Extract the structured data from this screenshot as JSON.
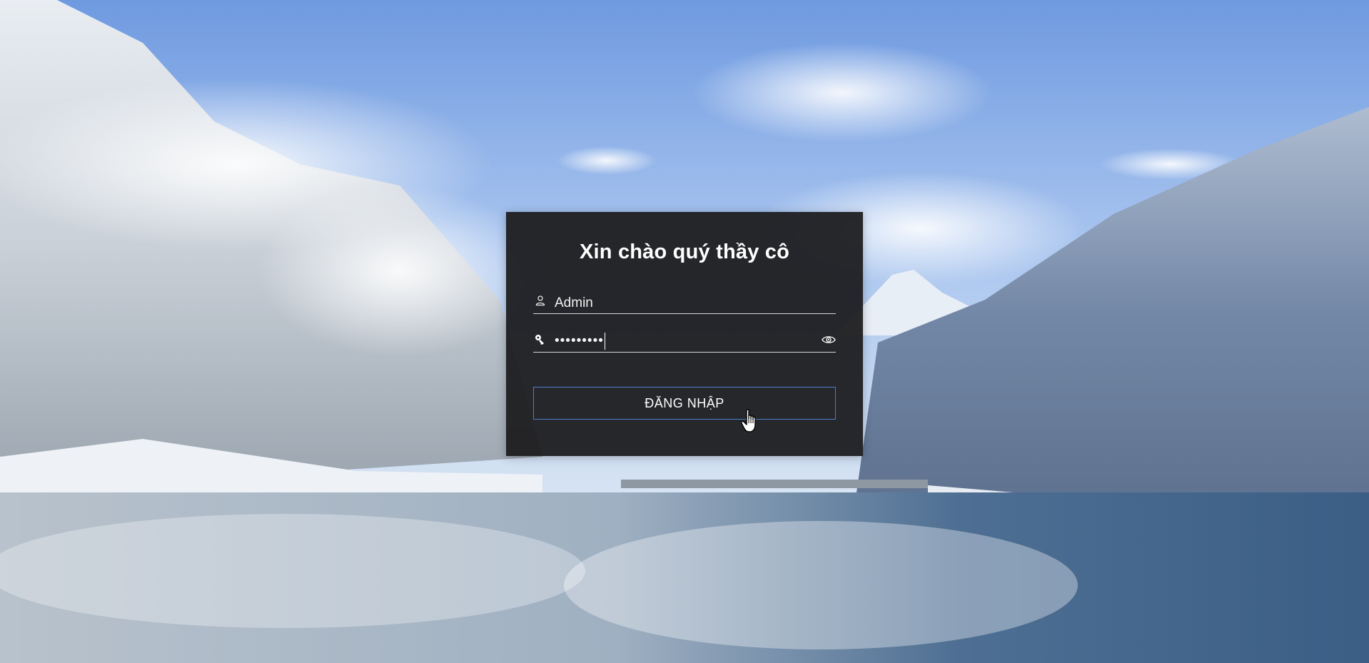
{
  "login": {
    "title": "Xin chào quý thầy cô",
    "username": {
      "value": "Admin",
      "icon": "user-icon"
    },
    "password": {
      "masked_value": "•••••••••",
      "icon": "key-icon",
      "toggle_icon": "eye-icon"
    },
    "submit_label": "ĐĂNG NHẬP"
  },
  "colors": {
    "card_background": "#1c1c1e",
    "button_border": "#4b7fcf",
    "text": "#ffffff"
  }
}
